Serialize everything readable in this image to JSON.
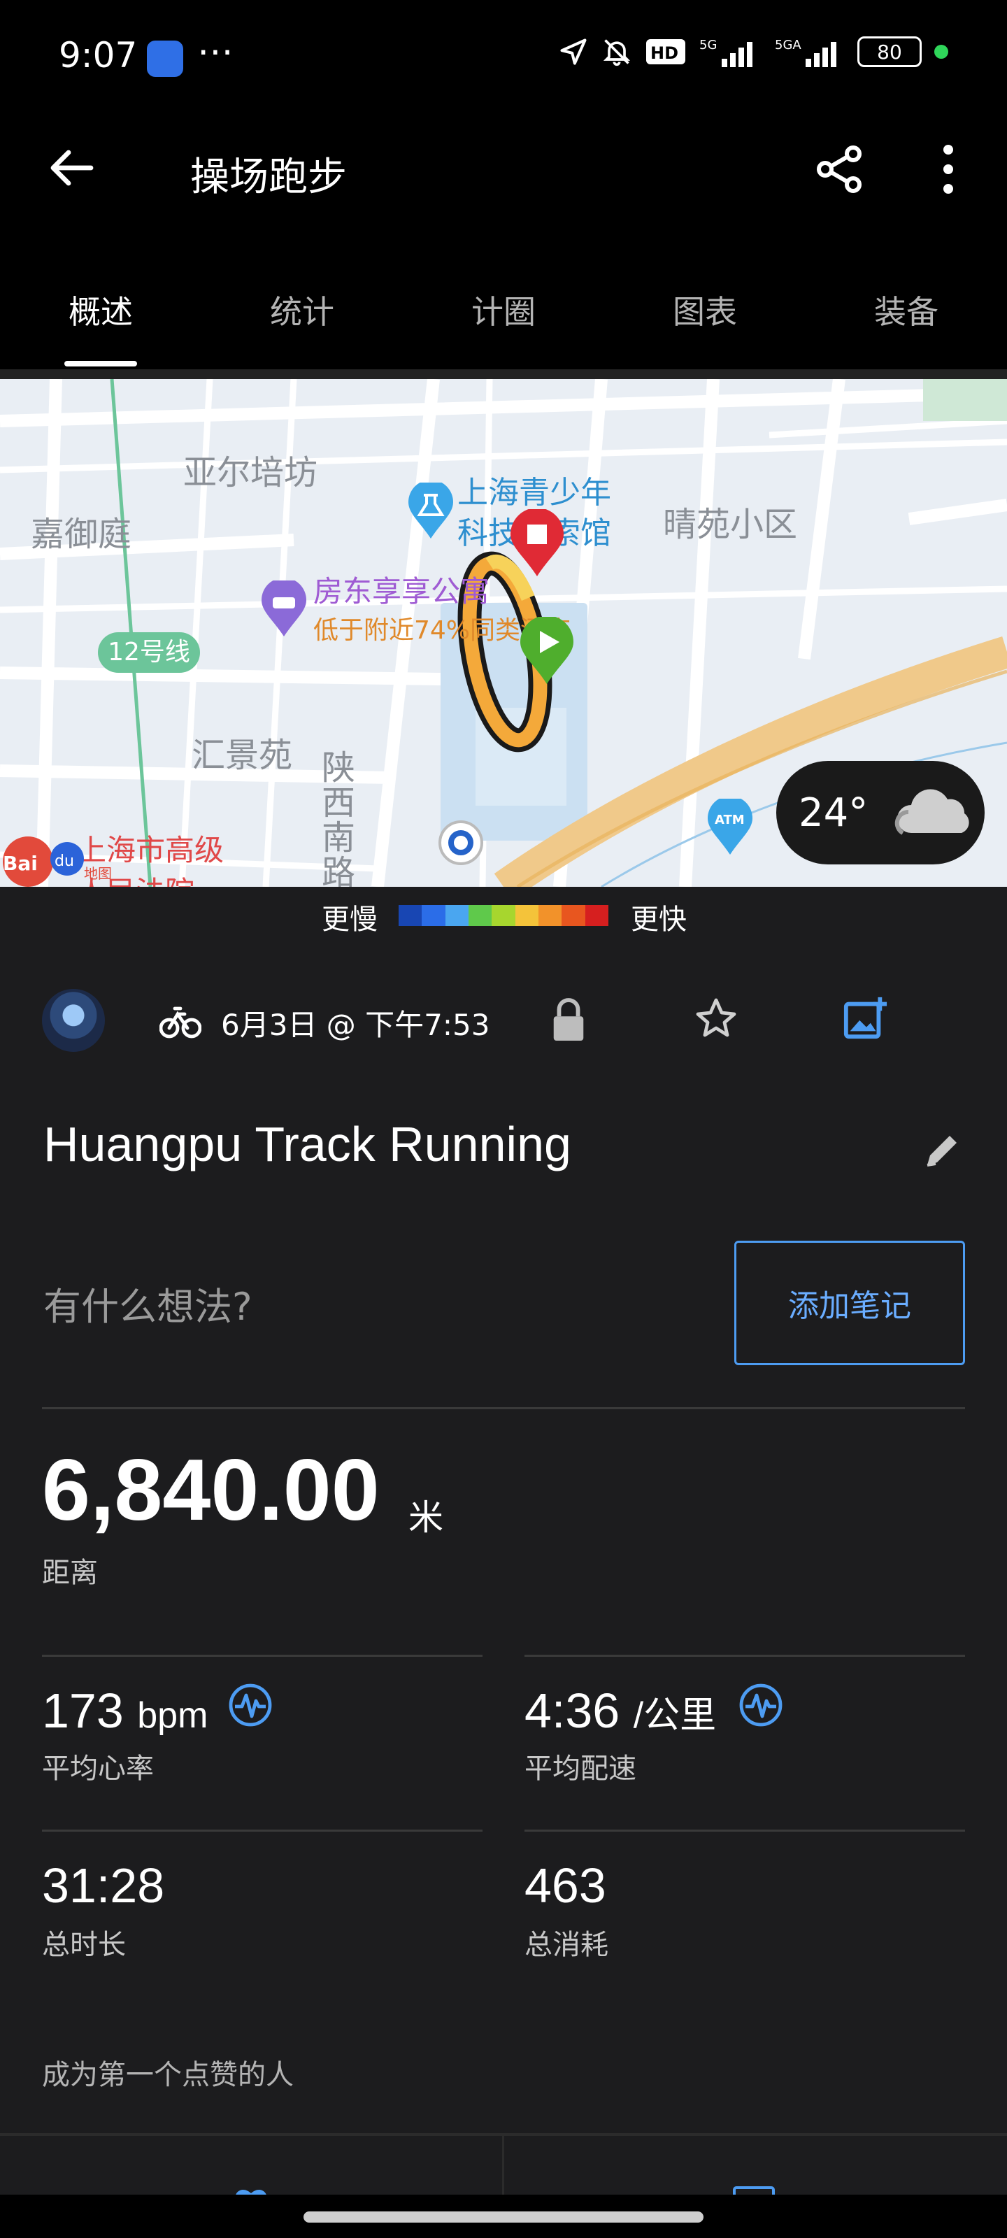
{
  "status_bar": {
    "time": "9:07",
    "battery": "80"
  },
  "header": {
    "title": "操场跑步"
  },
  "tabs": [
    {
      "label": "概述"
    },
    {
      "label": "统计"
    },
    {
      "label": "计圈"
    },
    {
      "label": "图表"
    },
    {
      "label": "装备"
    }
  ],
  "map": {
    "labels": [
      "亚尔培坊",
      "嘉御庭",
      "12号线",
      "汇景苑",
      "陕",
      "西",
      "南",
      "路",
      "晴苑小区",
      "上海青少年",
      "科技探索馆",
      "房东享享公寓",
      "低于附近74%同类酒店",
      "上海市高级",
      "人民法院"
    ],
    "weather": {
      "temperature": "24°",
      "icon": "cloud-icon"
    }
  },
  "pace_legend": {
    "slow_label": "更慢",
    "fast_label": "更快",
    "colors": [
      "#1846b3",
      "#2b6de8",
      "#4aa6f0",
      "#5fc94b",
      "#a7d62e",
      "#f4c33a",
      "#f2922a",
      "#e8561f",
      "#d61f1f"
    ]
  },
  "activity": {
    "date": "6月3日 @ 下午7:53",
    "name": "Huangpu Track Running",
    "note_prompt": "有什么想法?",
    "add_note_label": "添加笔记"
  },
  "stats": {
    "distance": {
      "value": "6,840.00",
      "unit": "米",
      "label": "距离"
    },
    "avg_hr": {
      "value": "173",
      "unit": "bpm",
      "label": "平均心率"
    },
    "avg_pace": {
      "value": "4:36",
      "unit": "/公里",
      "label": "平均配速"
    },
    "duration": {
      "value": "31:28",
      "label": "总时长"
    },
    "calories": {
      "value": "463",
      "label": "总消耗"
    }
  },
  "social": {
    "like_prompt": "成为第一个点赞的人"
  },
  "colors": {
    "accent": "#4d9cf2",
    "background": "#1c1c1e"
  }
}
